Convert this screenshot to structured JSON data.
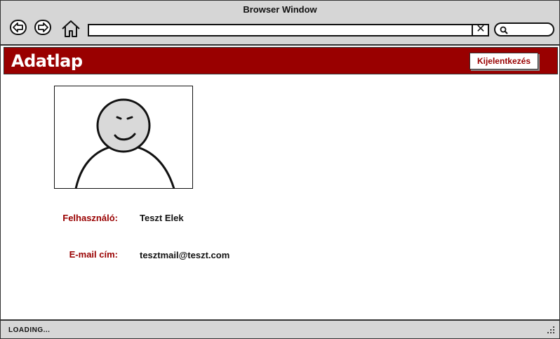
{
  "browser": {
    "title": "Browser Window",
    "back_icon": "arrow-left-icon",
    "forward_icon": "arrow-right-icon",
    "home_icon": "home-icon",
    "url_value": "",
    "clear_icon": "close-icon",
    "clear_symbol": "✕",
    "search_icon": "search-icon",
    "search_value": ""
  },
  "header": {
    "title": "Adatlap",
    "logout_label": "Kijelentkezés",
    "background_color": "#990000"
  },
  "profile": {
    "avatar_icon": "user-avatar-icon",
    "username_label": "Felhasználó:",
    "username_value": "Teszt Elek",
    "email_label": "E-mail cím:",
    "email_value": "tesztmail@teszt.com"
  },
  "status_bar": {
    "text": "LOADING...",
    "grip_icon": "resize-grip-icon"
  }
}
